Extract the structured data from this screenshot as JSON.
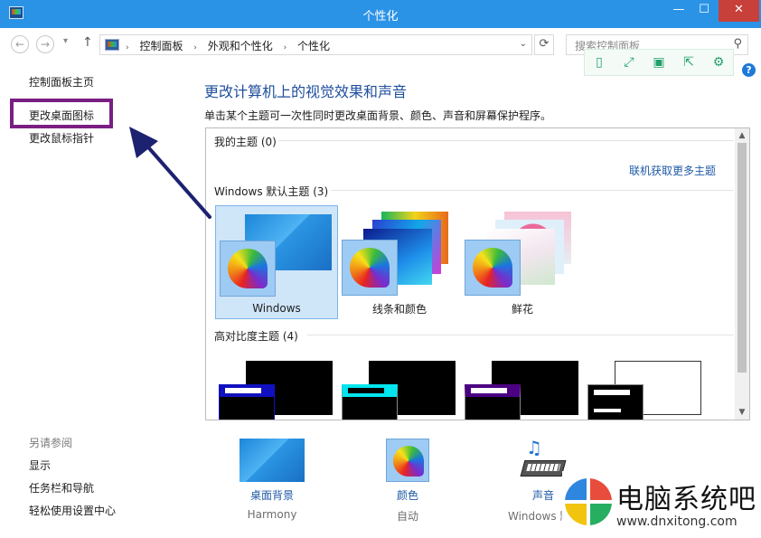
{
  "window": {
    "title": "个性化",
    "minimize_glyph": "—",
    "maximize_glyph": "☐",
    "close_glyph": "✕"
  },
  "nav": {
    "back_glyph": "←",
    "forward_glyph": "→",
    "recent_glyph": "▾",
    "up_glyph": "↑"
  },
  "address": {
    "crumbs": [
      "控制面板",
      "外观和个性化",
      "个性化"
    ],
    "separator": "›",
    "dropdown_glyph": "⌄",
    "refresh_glyph": "⟳"
  },
  "search": {
    "placeholder": "搜索控制面板",
    "icon_glyph": "⚲"
  },
  "overlay_tools": [
    {
      "name": "phone-icon",
      "glyph": "▯"
    },
    {
      "name": "fullscreen-icon",
      "glyph": "⤢"
    },
    {
      "name": "save-icon",
      "glyph": "▣"
    },
    {
      "name": "share-icon",
      "glyph": "⇱"
    },
    {
      "name": "settings-icon",
      "glyph": "⚙"
    }
  ],
  "help": {
    "glyph": "?"
  },
  "sidebar": {
    "home": "控制面板主页",
    "desktop_icons": "更改桌面图标",
    "mouse_pointers": "更改鼠标指针",
    "see_also_title": "另请参阅",
    "see_also": [
      "显示",
      "任务栏和导航",
      "轻松使用设置中心"
    ]
  },
  "main": {
    "heading": "更改计算机上的视觉效果和声音",
    "description": "单击某个主题可一次性同时更改桌面背景、颜色、声音和屏幕保护程序。"
  },
  "themes": {
    "my_themes": "我的主题 (0)",
    "online_link": "联机获取更多主题",
    "default_group": "Windows 默认主题 (3)",
    "default_themes": [
      {
        "label": "Windows",
        "selected": true
      },
      {
        "label": "线条和颜色",
        "selected": false
      },
      {
        "label": "鲜花",
        "selected": false
      }
    ],
    "high_contrast_group": "高对比度主题 (4)",
    "high_contrast": [
      {
        "small_bg": "#000000",
        "accent": "#ffff00",
        "bar_color": "#00008b"
      },
      {
        "small_bg": "#000000",
        "accent": "#00ff00",
        "bar_color": "#00ffff"
      },
      {
        "small_bg": "#000000",
        "accent": "#ffffff",
        "bar_color": "#4b0082"
      },
      {
        "small_bg": "#ffffff",
        "accent": "#000000",
        "bar_color": "#000000"
      }
    ],
    "scroll_up_glyph": "▲",
    "scroll_down_glyph": "▼"
  },
  "bottom": [
    {
      "label": "桌面背景",
      "value": "Harmony"
    },
    {
      "label": "颜色",
      "value": "自动"
    },
    {
      "label": "声音",
      "value": "Windows 默"
    }
  ],
  "watermark": {
    "name": "电脑系统吧",
    "url": "www.dnxitong.com"
  },
  "colors": {
    "titlebar": "#2b93e6",
    "link": "#1f5aa6",
    "heading": "#1f4e9c",
    "highlight_box": "#7a1f82",
    "annotation_arrow": "#1c2170",
    "selection": "#cfe5f8"
  }
}
